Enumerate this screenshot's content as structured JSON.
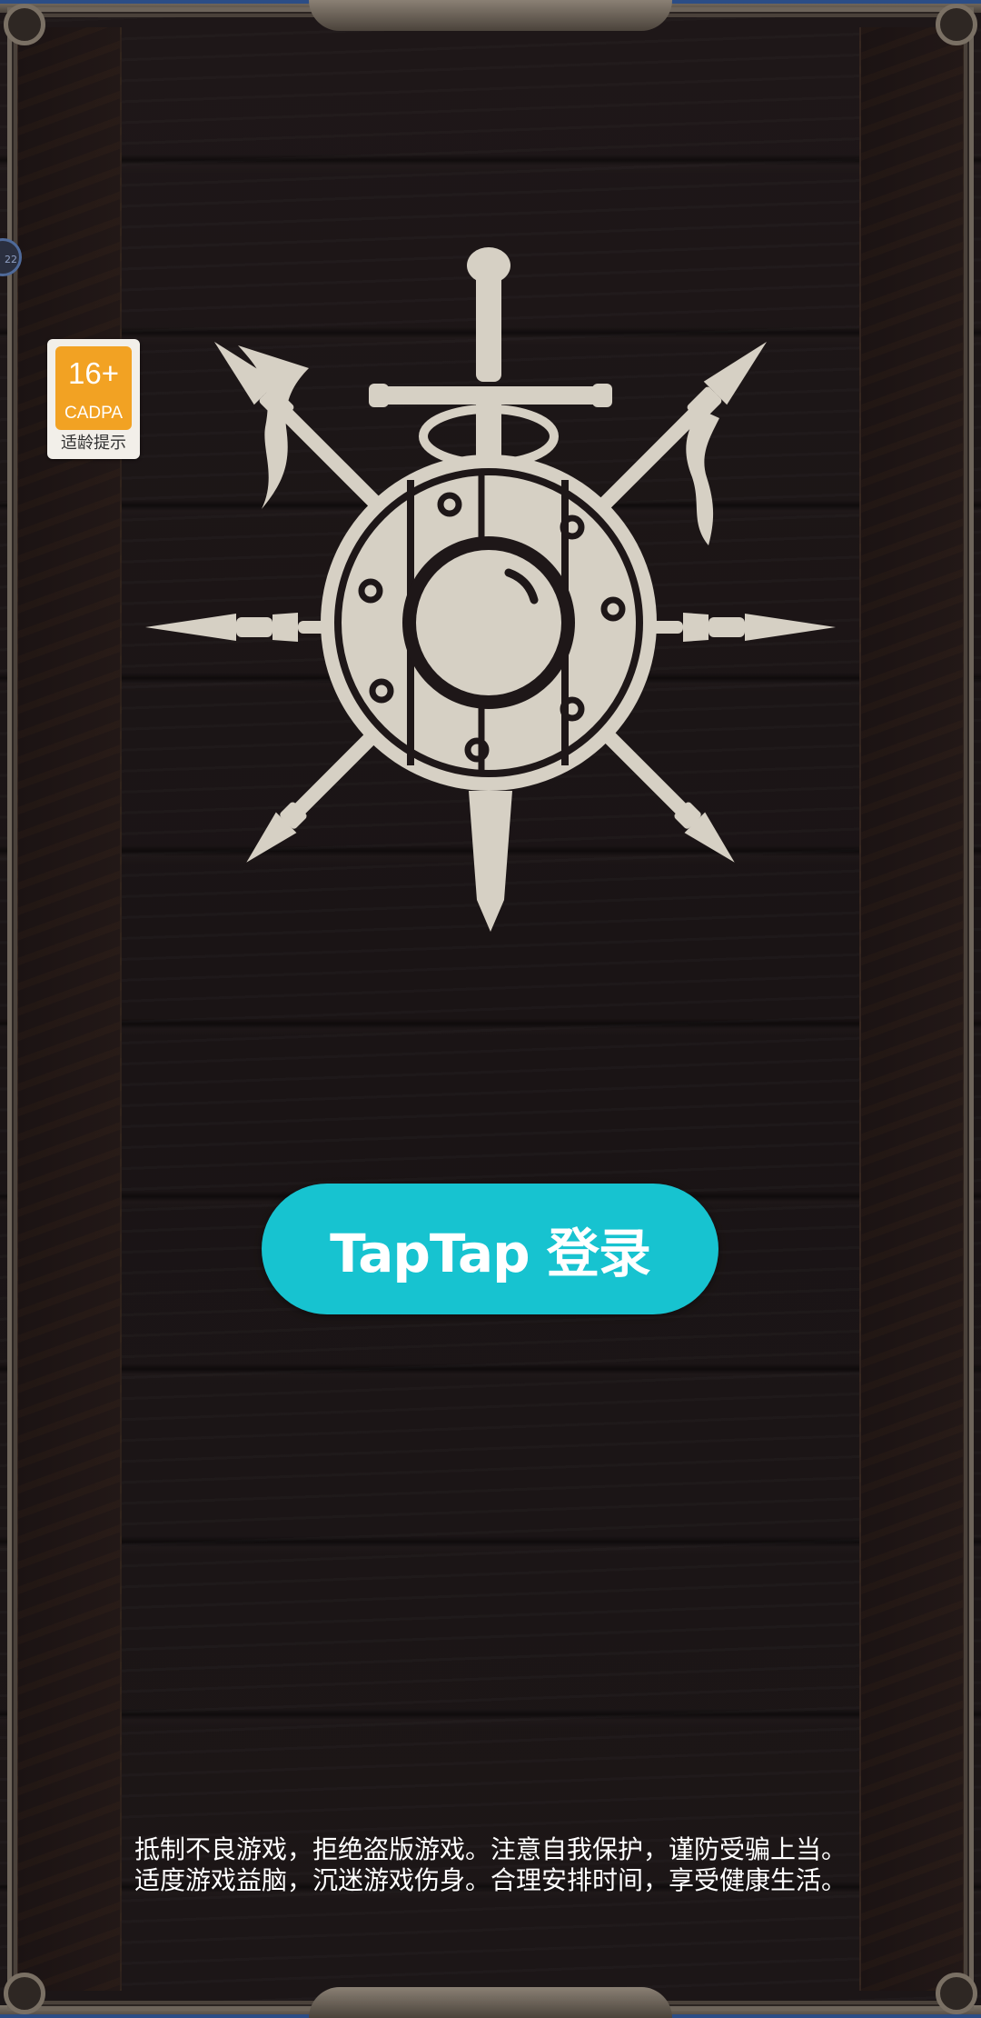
{
  "age_rating": {
    "age": "16+",
    "organization": "CADPA",
    "hint": "适龄提示"
  },
  "edge_bubble": {
    "text": "22"
  },
  "login": {
    "label": "TapTap 登录"
  },
  "advisory": {
    "line1": "抵制不良游戏，拒绝盗版游戏。注意自我保护，谨防受骗上当。",
    "line2": "适度游戏益脑，沉迷游戏伤身。合理安排时间，享受健康生活。"
  },
  "colors": {
    "background": "#1a1415",
    "emblem": "#d6d0c4",
    "login_button": "#17c3d0",
    "badge_orange": "#f2a223"
  },
  "emblem": {
    "icon": "shield-sword-spears-icon"
  }
}
